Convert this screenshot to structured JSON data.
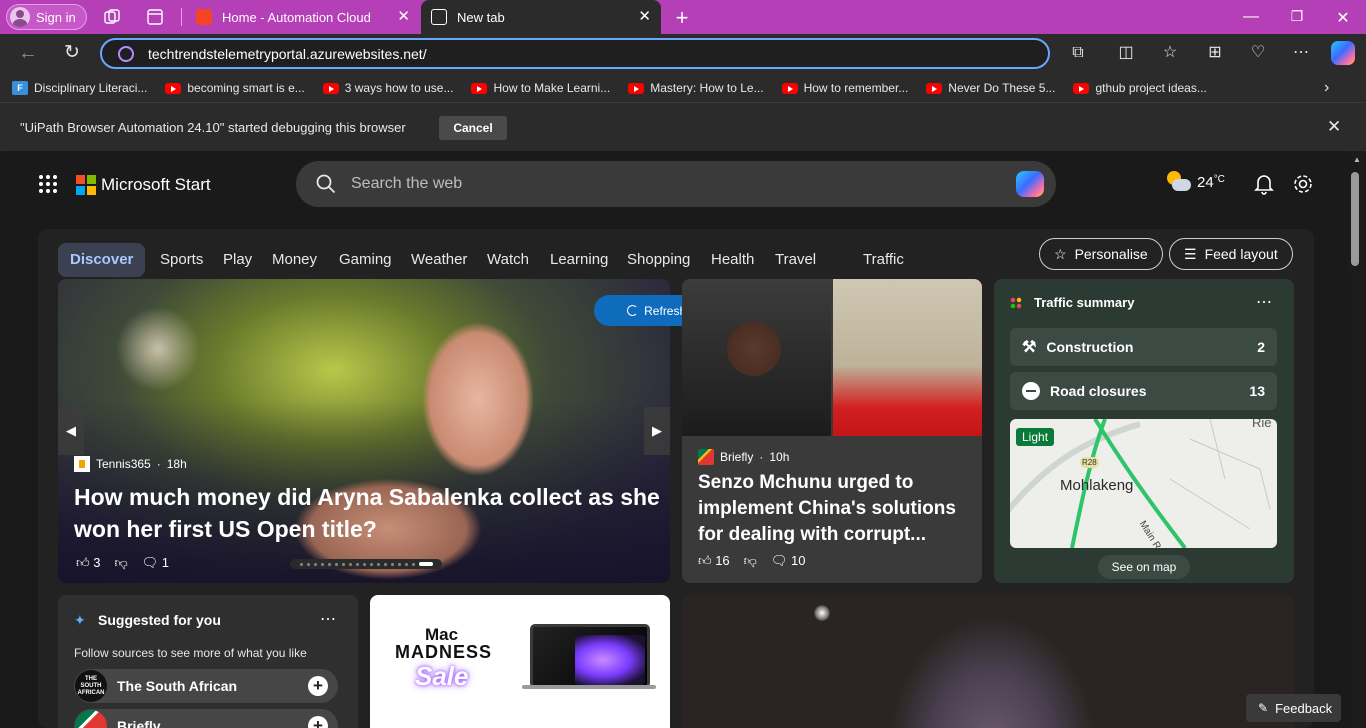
{
  "browser": {
    "signin_label": "Sign in",
    "tabs": [
      {
        "title": "Home - Automation Cloud"
      },
      {
        "title": "New tab"
      }
    ],
    "address": "techtrendstelemetryportal.azurewebsites.net/",
    "bookmarks": [
      {
        "label": "Disciplinary Literaci...",
        "icon": "form-icon"
      },
      {
        "label": "becoming smart is e...",
        "icon": "youtube-icon"
      },
      {
        "label": "3 ways how to use...",
        "icon": "youtube-icon"
      },
      {
        "label": "How to Make Learni...",
        "icon": "youtube-icon"
      },
      {
        "label": "Mastery: How to Le...",
        "icon": "youtube-icon"
      },
      {
        "label": "How to remember...",
        "icon": "youtube-icon"
      },
      {
        "label": "Never Do These 5...",
        "icon": "youtube-icon"
      },
      {
        "label": "gthub project ideas...",
        "icon": "youtube-icon"
      }
    ],
    "debug_message": "\"UiPath Browser Automation 24.10\" started debugging this browser",
    "debug_cancel": "Cancel",
    "colors": {
      "tabstrip": "#b43fb6",
      "address_border": "#6aa6ff"
    }
  },
  "msn": {
    "brand": "Microsoft Start",
    "search_placeholder": "Search the web",
    "weather_temp": "24",
    "weather_unit": "°C",
    "nav": [
      "Discover",
      "Sports",
      "Play",
      "Money",
      "Gaming",
      "Weather",
      "Watch",
      "Learning",
      "Shopping",
      "Health",
      "Travel",
      "Traffic"
    ],
    "personalise": "Personalise",
    "feed_layout": "Feed layout",
    "refresh_stories": "Refresh stories",
    "hero": {
      "source": "Tennis365",
      "age": "18h",
      "headline": "How much money did Aryna Sabalenka collect as she won her first US Open title?",
      "likes": "3",
      "comments": "1"
    },
    "story2": {
      "source": "Briefly",
      "age": "10h",
      "headline": "Senzo Mchunu urged to implement China's solutions for dealing with corrupt...",
      "likes": "16",
      "comments": "10"
    },
    "traffic": {
      "title": "Traffic summary",
      "rows": [
        {
          "label": "Construction",
          "count": "2"
        },
        {
          "label": "Road closures",
          "count": "13"
        }
      ],
      "map_badge": "Light",
      "map_place": "Mohlakeng",
      "map_road": "R28",
      "map_street": "Main Road",
      "map_corner": "Rie",
      "see_on_map": "See on map"
    },
    "suggested": {
      "title": "Suggested for you",
      "subtitle": "Follow sources to see more of what you like",
      "sources": [
        {
          "name": "The South African",
          "logo_text": "THE SOUTH AFRICAN"
        },
        {
          "name": "Briefly"
        }
      ]
    },
    "ad": {
      "line1": "Mac",
      "line2": "MADNESS",
      "line3": "Sale"
    },
    "feedback": "Feedback"
  }
}
